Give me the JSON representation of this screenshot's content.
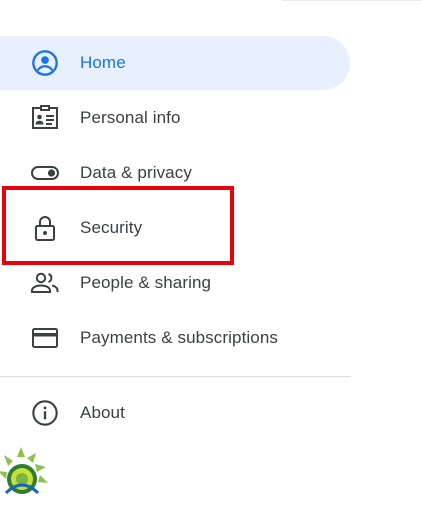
{
  "nav": {
    "items": [
      {
        "label": "Home",
        "icon": "account-circle-icon",
        "active": true
      },
      {
        "label": "Personal info",
        "icon": "id-card-icon",
        "active": false
      },
      {
        "label": "Data & privacy",
        "icon": "toggle-icon",
        "active": false
      },
      {
        "label": "Security",
        "icon": "lock-icon",
        "active": false
      },
      {
        "label": "People & sharing",
        "icon": "people-icon",
        "active": false
      },
      {
        "label": "Payments & subscriptions",
        "icon": "credit-card-icon",
        "active": false
      }
    ],
    "about": {
      "label": "About",
      "icon": "info-icon"
    }
  },
  "colors": {
    "accent": "#1a73e8",
    "active_bg": "#e8f0fe",
    "icon": "#3c4043",
    "highlight": "#e8000d"
  }
}
